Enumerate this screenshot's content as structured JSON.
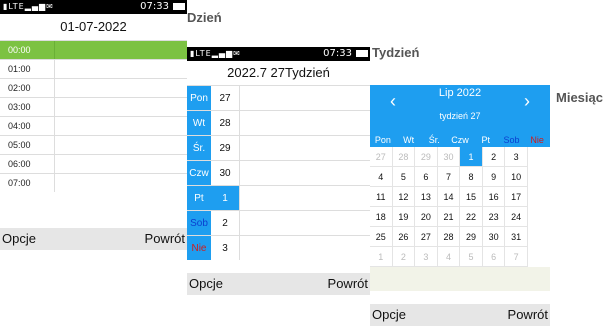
{
  "status": {
    "network": "LTE",
    "time": "07:33"
  },
  "softkeys": {
    "left": "Opcje",
    "right": "Powrót"
  },
  "day": {
    "title": "Dzień",
    "date": "01-07-2022",
    "hours": [
      "00:00",
      "01:00",
      "02:00",
      "03:00",
      "04:00",
      "05:00",
      "06:00",
      "07:00"
    ],
    "selected_hour": "00:00"
  },
  "week": {
    "title": "Tydzień",
    "header": "2022.7 27Tydzień",
    "days": [
      {
        "label": "Pon",
        "num": "27"
      },
      {
        "label": "Wt",
        "num": "28"
      },
      {
        "label": "Śr.",
        "num": "29"
      },
      {
        "label": "Czw",
        "num": "30"
      },
      {
        "label": "Pt",
        "num": "1"
      },
      {
        "label": "Sob",
        "num": "2"
      },
      {
        "label": "Nie",
        "num": "3"
      }
    ],
    "selected_day": "Pt"
  },
  "month": {
    "title": "Miesiąc",
    "month_label": "Lip 2022",
    "week_label": "tydzień 27",
    "prev_icon": "chevron-left-icon",
    "next_icon": "chevron-right-icon",
    "dow": [
      "Pon",
      "Wt",
      "Śr.",
      "Czw",
      "Pt",
      "Sob",
      "Nie"
    ],
    "weeks": [
      [
        "27",
        "28",
        "29",
        "30",
        "1",
        "2",
        "3"
      ],
      [
        "4",
        "5",
        "6",
        "7",
        "8",
        "9",
        "10"
      ],
      [
        "11",
        "12",
        "13",
        "14",
        "15",
        "16",
        "17"
      ],
      [
        "18",
        "19",
        "20",
        "21",
        "22",
        "23",
        "24"
      ],
      [
        "25",
        "26",
        "27",
        "28",
        "29",
        "30",
        "31"
      ],
      [
        "1",
        "2",
        "3",
        "4",
        "5",
        "6",
        "7"
      ]
    ],
    "selected": "1"
  },
  "colors": {
    "accent": "#1e9ef0",
    "green": "#7cc242",
    "weekend_sat": "#0b3fd0",
    "weekend_sun": "#d21b1b"
  }
}
